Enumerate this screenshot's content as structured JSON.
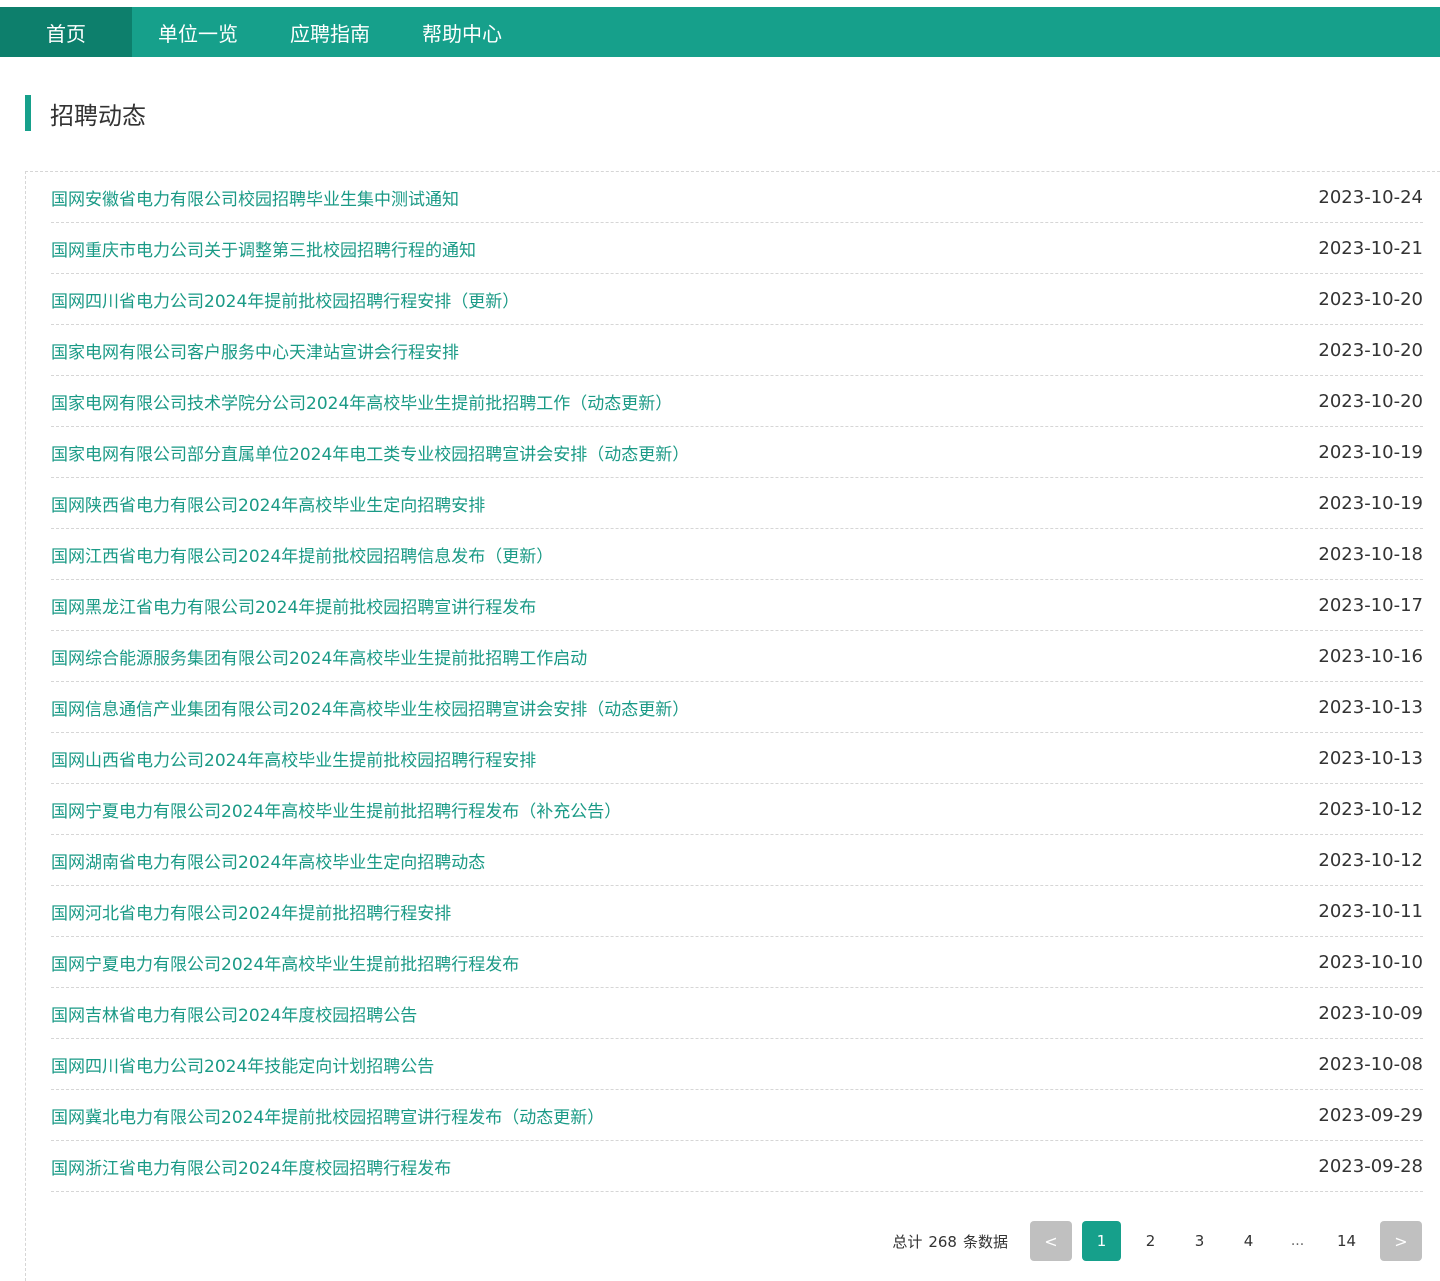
{
  "nav": {
    "items": [
      {
        "label": "首页",
        "active": true
      },
      {
        "label": "单位一览",
        "active": false
      },
      {
        "label": "应聘指南",
        "active": false
      },
      {
        "label": "帮助中心",
        "active": false
      }
    ]
  },
  "section": {
    "title": "招聘动态"
  },
  "news": [
    {
      "title": "国网安徽省电力有限公司校园招聘毕业生集中测试通知",
      "date": "2023-10-24"
    },
    {
      "title": "国网重庆市电力公司关于调整第三批校园招聘行程的通知",
      "date": "2023-10-21"
    },
    {
      "title": "国网四川省电力公司2024年提前批校园招聘行程安排（更新）",
      "date": "2023-10-20"
    },
    {
      "title": "国家电网有限公司客户服务中心天津站宣讲会行程安排",
      "date": "2023-10-20"
    },
    {
      "title": "国家电网有限公司技术学院分公司2024年高校毕业生提前批招聘工作（动态更新）",
      "date": "2023-10-20"
    },
    {
      "title": "国家电网有限公司部分直属单位2024年电工类专业校园招聘宣讲会安排（动态更新）",
      "date": "2023-10-19"
    },
    {
      "title": "国网陕西省电力有限公司2024年高校毕业生定向招聘安排",
      "date": "2023-10-19"
    },
    {
      "title": "国网江西省电力有限公司2024年提前批校园招聘信息发布（更新）",
      "date": "2023-10-18"
    },
    {
      "title": "国网黑龙江省电力有限公司2024年提前批校园招聘宣讲行程发布",
      "date": "2023-10-17"
    },
    {
      "title": "国网综合能源服务集团有限公司2024年高校毕业生提前批招聘工作启动",
      "date": "2023-10-16"
    },
    {
      "title": "国网信息通信产业集团有限公司2024年高校毕业生校园招聘宣讲会安排（动态更新）",
      "date": "2023-10-13"
    },
    {
      "title": "国网山西省电力公司2024年高校毕业生提前批校园招聘行程安排",
      "date": "2023-10-13"
    },
    {
      "title": "国网宁夏电力有限公司2024年高校毕业生提前批招聘行程发布（补充公告）",
      "date": "2023-10-12"
    },
    {
      "title": "国网湖南省电力有限公司2024年高校毕业生定向招聘动态",
      "date": "2023-10-12"
    },
    {
      "title": "国网河北省电力有限公司2024年提前批招聘行程安排",
      "date": "2023-10-11"
    },
    {
      "title": "国网宁夏电力有限公司2024年高校毕业生提前批招聘行程发布",
      "date": "2023-10-10"
    },
    {
      "title": "国网吉林省电力有限公司2024年度校园招聘公告",
      "date": "2023-10-09"
    },
    {
      "title": "国网四川省电力公司2024年技能定向计划招聘公告",
      "date": "2023-10-08"
    },
    {
      "title": "国网冀北电力有限公司2024年提前批校园招聘宣讲行程发布（动态更新）",
      "date": "2023-09-29"
    },
    {
      "title": "国网浙江省电力有限公司2024年度校园招聘行程发布",
      "date": "2023-09-28"
    }
  ],
  "pagination": {
    "total_prefix": "总计",
    "total_count": "268",
    "total_suffix": "条数据",
    "prev_label": "<",
    "next_label": ">",
    "pages": [
      "1",
      "2",
      "3",
      "4"
    ],
    "ellipsis": "...",
    "last_page": "14",
    "current_page": "1"
  },
  "colors": {
    "accent": "#16a08b",
    "accent_dark": "#0d7f6c",
    "link": "#1a9a86"
  }
}
